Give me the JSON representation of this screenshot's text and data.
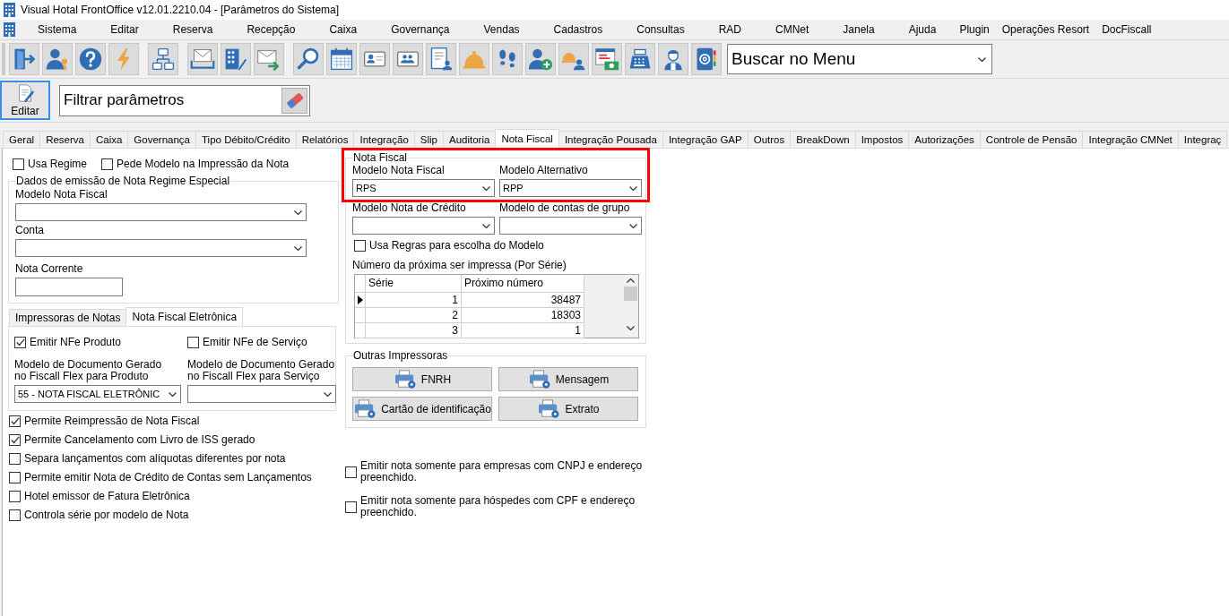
{
  "window": {
    "title": "Visual Hotal FrontOffice v12.01.2210.04 - [Parâmetros do Sistema]"
  },
  "menu": {
    "items": [
      "Sistema",
      "Editar",
      "Reserva",
      "Recepção",
      "Caixa",
      "Governança",
      "Vendas",
      "Cadastros",
      "Consultas",
      "RAD",
      "CMNet",
      "Janela",
      "Ajuda",
      "Plugin",
      "Operações Resort",
      "DocFiscall"
    ]
  },
  "toolbar": {
    "search": {
      "value": "Buscar no Menu"
    }
  },
  "actions": {
    "edit_button": {
      "label": "Editar"
    },
    "filter": {
      "value": "Filtrar parâmetros"
    }
  },
  "tabs": [
    {
      "label": "Geral",
      "selected": false
    },
    {
      "label": "Reserva",
      "selected": false
    },
    {
      "label": "Caixa",
      "selected": false
    },
    {
      "label": "Governança",
      "selected": false
    },
    {
      "label": "Tipo Débito/Crédito",
      "selected": false
    },
    {
      "label": "Relatórios",
      "selected": false
    },
    {
      "label": "Integração",
      "selected": false
    },
    {
      "label": "Slip",
      "selected": false
    },
    {
      "label": "Auditoria",
      "selected": false
    },
    {
      "label": "Nota Fiscal",
      "selected": true
    },
    {
      "label": "Integração Pousada",
      "selected": false
    },
    {
      "label": "Integração GAP",
      "selected": false
    },
    {
      "label": "Outros",
      "selected": false
    },
    {
      "label": "BreakDown",
      "selected": false
    },
    {
      "label": "Impostos",
      "selected": false
    },
    {
      "label": "Autorizações",
      "selected": false
    },
    {
      "label": "Controle de Pensão",
      "selected": false
    },
    {
      "label": "Integração CMNet",
      "selected": false
    },
    {
      "label": "Integraç",
      "selected": false
    }
  ],
  "general": {
    "top_checks": [
      {
        "label": "Usa Regime",
        "checked": false
      },
      {
        "label": "Pede Modelo na Impressão da Nota",
        "checked": false
      }
    ],
    "regime_group": {
      "title": "Dados de emissão de Nota Regime Especial",
      "fields": [
        {
          "kind": "dropdown",
          "label": "Modelo Nota Fiscal"
        },
        {
          "kind": "dropdown",
          "label": "Conta"
        },
        {
          "kind": "text",
          "label": "Nota Corrente"
        }
      ]
    },
    "sub_tabs": [
      {
        "label": "Impressoras de Notas",
        "selected": false
      },
      {
        "label": "Nota Fiscal Eletrônica",
        "selected": true
      }
    ],
    "nfe": {
      "checks": [
        {
          "label": "Emitir NFe Produto",
          "checked": true
        },
        {
          "label": "Emitir NFe de Serviço",
          "checked": false
        }
      ],
      "fields": [
        {
          "label": "Modelo de Documento Gerado no Fiscall Flex para Produto",
          "value": "55 - NOTA FISCAL ELETRÔNIC"
        },
        {
          "label": "Modelo de Documento Gerado no Fiscall Flex para Serviço"
        }
      ]
    },
    "options": [
      {
        "label": "Permite Reimpressão de Nota Fiscal",
        "checked": true
      },
      {
        "label": "Permite Cancelamento com Livro de ISS gerado",
        "checked": true
      },
      {
        "label": "Separa lançamentos com alíquotas diferentes por nota",
        "checked": false
      },
      {
        "label": "Permite emitir Nota de Crédito de Contas sem Lançamentos",
        "checked": false
      },
      {
        "label": "Hotel emissor de Fatura Eletrônica",
        "checked": false
      },
      {
        "label": "Controla série por modelo de Nota",
        "checked": false
      }
    ]
  },
  "nota_fiscal": {
    "title": "Nota Fiscal",
    "highlighted": true,
    "fields": [
      {
        "label": "Modelo Nota Fiscal",
        "value": "RPS"
      },
      {
        "label": "Modelo Alternativo",
        "value": "RPP"
      },
      {
        "label": "Modelo Nota de Crédito"
      },
      {
        "label": "Modelo de contas de grupo"
      }
    ],
    "rules_check": {
      "label": "Usa Regras para escolha do Modelo",
      "checked": false
    },
    "series_caption": "Número da próxima ser impressa (Por Série)",
    "series_table": {
      "columns": [
        "Série",
        "Próximo número"
      ],
      "rows": [
        {
          "cells": [
            "1",
            "38487"
          ],
          "selected": true
        },
        {
          "cells": [
            "2",
            "18303"
          ],
          "selected": false
        },
        {
          "cells": [
            "3",
            "1"
          ],
          "selected": false
        }
      ]
    }
  },
  "other_printers": {
    "title": "Outras Impressoras",
    "buttons": [
      "FNRH",
      "Mensagem",
      "Cartão de identificação",
      "Extrato"
    ]
  },
  "restrictions": [
    {
      "label": "Emitir nota somente para empresas com CNPJ e endereço preenchido.",
      "checked": false
    },
    {
      "label": "Emitir nota somente para hóspedes com CPF e endereço preenchido.",
      "checked": false
    }
  ]
}
